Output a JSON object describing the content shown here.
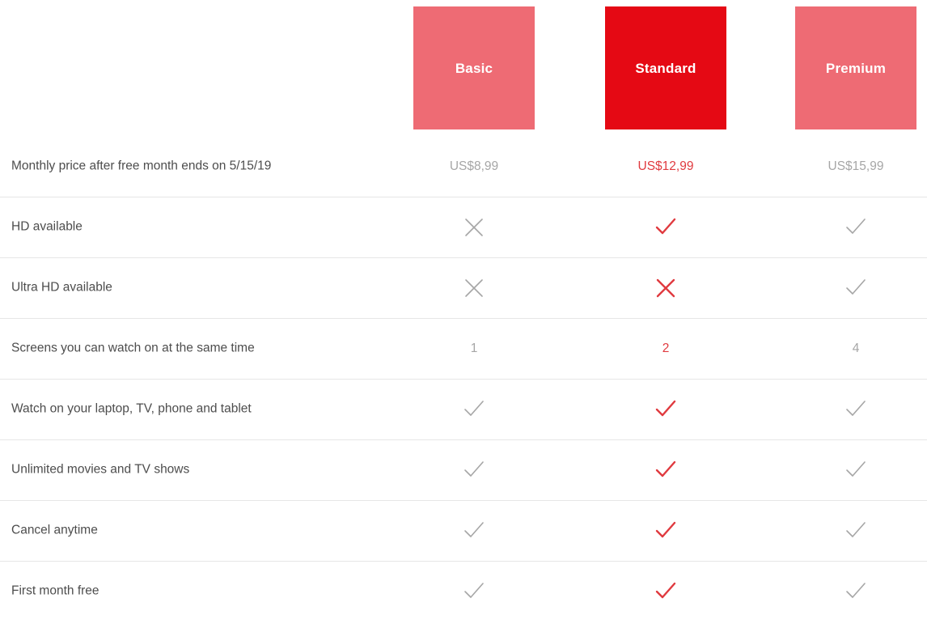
{
  "colors": {
    "plan_inactive": "#ee6b74",
    "plan_active": "#e50914",
    "accent_text": "#e03a3f",
    "muted_text": "#a6a6a6",
    "label_text": "#4d4d4d",
    "divider": "#e6e6e6",
    "background": "#ffffff"
  },
  "plans": [
    {
      "name": "Basic",
      "highlighted": false
    },
    {
      "name": "Standard",
      "highlighted": true
    },
    {
      "name": "Premium",
      "highlighted": false
    }
  ],
  "rows": [
    {
      "label": "Monthly price after free month ends on 5/15/19",
      "cells": [
        {
          "kind": "text",
          "value": "US$8,99",
          "tone": "muted"
        },
        {
          "kind": "text",
          "value": "US$12,99",
          "tone": "accent"
        },
        {
          "kind": "text",
          "value": "US$15,99",
          "tone": "muted"
        }
      ]
    },
    {
      "label": "HD available",
      "cells": [
        {
          "kind": "icon",
          "icon": "cross-icon",
          "tone": "muted"
        },
        {
          "kind": "icon",
          "icon": "check-icon",
          "tone": "accent"
        },
        {
          "kind": "icon",
          "icon": "check-icon",
          "tone": "muted"
        }
      ]
    },
    {
      "label": "Ultra HD available",
      "cells": [
        {
          "kind": "icon",
          "icon": "cross-icon",
          "tone": "muted"
        },
        {
          "kind": "icon",
          "icon": "cross-icon",
          "tone": "accent"
        },
        {
          "kind": "icon",
          "icon": "check-icon",
          "tone": "muted"
        }
      ]
    },
    {
      "label": "Screens you can watch on at the same time",
      "cells": [
        {
          "kind": "text",
          "value": "1",
          "tone": "muted"
        },
        {
          "kind": "text",
          "value": "2",
          "tone": "accent"
        },
        {
          "kind": "text",
          "value": "4",
          "tone": "muted"
        }
      ]
    },
    {
      "label": "Watch on your laptop, TV, phone and tablet",
      "cells": [
        {
          "kind": "icon",
          "icon": "check-icon",
          "tone": "muted"
        },
        {
          "kind": "icon",
          "icon": "check-icon",
          "tone": "accent"
        },
        {
          "kind": "icon",
          "icon": "check-icon",
          "tone": "muted"
        }
      ]
    },
    {
      "label": "Unlimited movies and TV shows",
      "cells": [
        {
          "kind": "icon",
          "icon": "check-icon",
          "tone": "muted"
        },
        {
          "kind": "icon",
          "icon": "check-icon",
          "tone": "accent"
        },
        {
          "kind": "icon",
          "icon": "check-icon",
          "tone": "muted"
        }
      ]
    },
    {
      "label": "Cancel anytime",
      "cells": [
        {
          "kind": "icon",
          "icon": "check-icon",
          "tone": "muted"
        },
        {
          "kind": "icon",
          "icon": "check-icon",
          "tone": "accent"
        },
        {
          "kind": "icon",
          "icon": "check-icon",
          "tone": "muted"
        }
      ]
    },
    {
      "label": "First month free",
      "cells": [
        {
          "kind": "icon",
          "icon": "check-icon",
          "tone": "muted"
        },
        {
          "kind": "icon",
          "icon": "check-icon",
          "tone": "accent"
        },
        {
          "kind": "icon",
          "icon": "check-icon",
          "tone": "muted"
        }
      ]
    }
  ]
}
